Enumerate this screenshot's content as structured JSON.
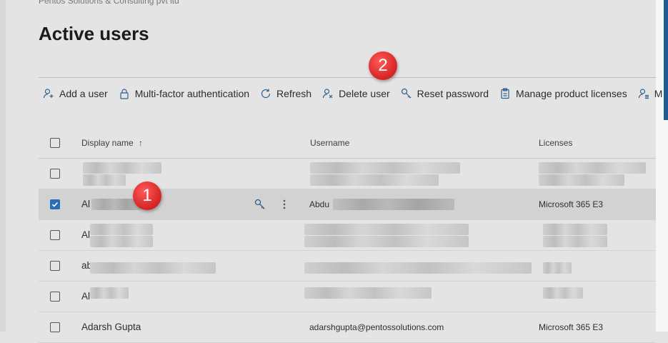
{
  "header": {
    "org_name": "Pentos Solutions & Consulting pvt ltd",
    "page_title": "Active users"
  },
  "toolbar": {
    "add_user": "Add a user",
    "mfa": "Multi-factor authentication",
    "refresh": "Refresh",
    "delete_user": "Delete user",
    "reset_password": "Reset password",
    "manage_licenses": "Manage product licenses",
    "more": "M"
  },
  "table": {
    "columns": {
      "display_name": "Display name",
      "sort_indicator": "↑",
      "username": "Username",
      "licenses": "Licenses"
    },
    "rows": [
      {
        "name": "",
        "username": "",
        "license": "",
        "checked": false
      },
      {
        "name": "Al",
        "username": "Abdu",
        "license": "Microsoft 365 E3",
        "checked": true
      },
      {
        "name": "Al",
        "username": "",
        "license": "",
        "checked": false
      },
      {
        "name": "ab",
        "username": "",
        "license": "",
        "checked": false
      },
      {
        "name": "Al",
        "username": "",
        "license": "",
        "checked": false
      },
      {
        "name": "Adarsh Gupta",
        "username": "adarshgupta@pentossolutions.com",
        "license": "Microsoft 365 E3",
        "checked": false
      }
    ]
  },
  "annotations": {
    "badge_1": "1",
    "badge_2": "2"
  }
}
